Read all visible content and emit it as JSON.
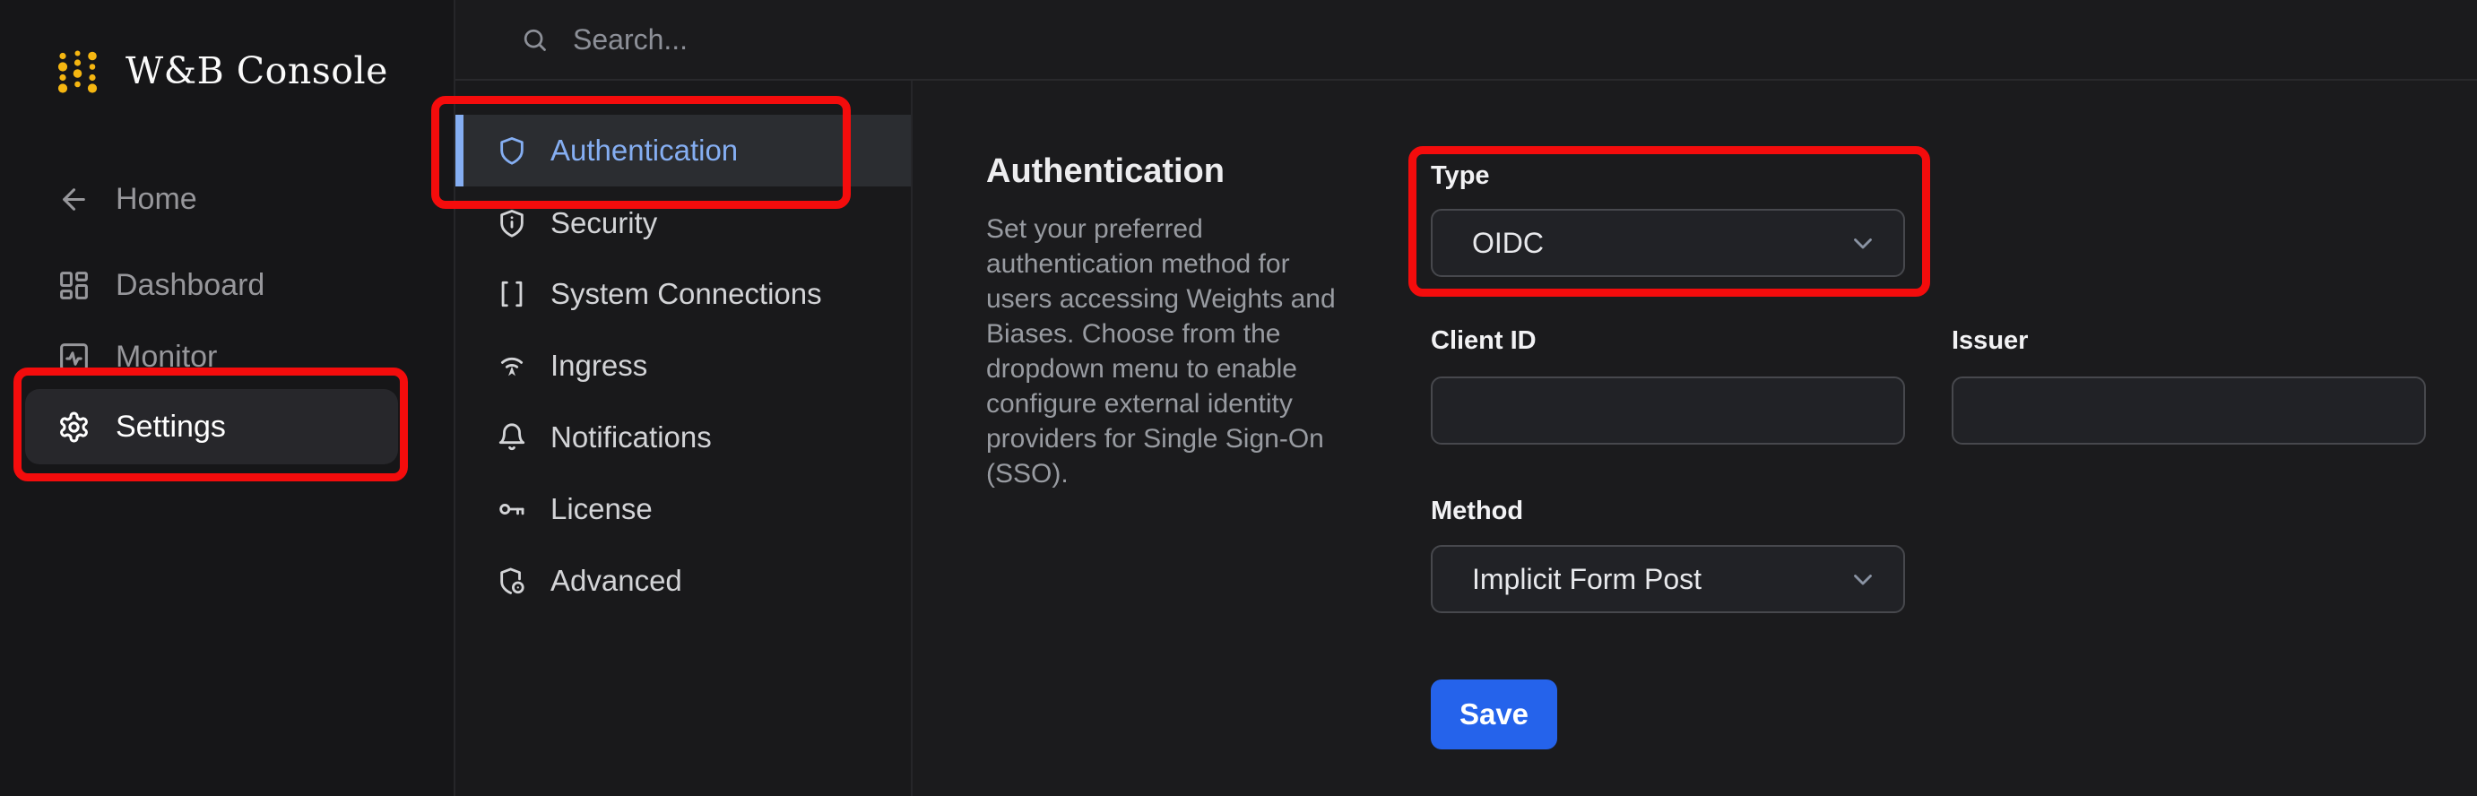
{
  "app": {
    "title": "W&B Console",
    "logo_icon": "wandb-dots-icon"
  },
  "topbar": {
    "search_placeholder": "Search...",
    "search_icon": "magnifier-icon"
  },
  "sidebar": {
    "items": [
      {
        "label": "Home",
        "icon": "arrow-left-icon",
        "selected": false
      },
      {
        "label": "Dashboard",
        "icon": "dashboard-icon",
        "selected": false
      },
      {
        "label": "Monitor",
        "icon": "monitor-icon",
        "selected": false
      },
      {
        "label": "Settings",
        "icon": "gear-icon",
        "selected": true
      }
    ]
  },
  "subnav": {
    "items": [
      {
        "label": "Authentication",
        "icon": "shield-icon",
        "selected": true
      },
      {
        "label": "Security",
        "icon": "shield-info-icon",
        "selected": false
      },
      {
        "label": "System Connections",
        "icon": "brackets-icon",
        "selected": false
      },
      {
        "label": "Ingress",
        "icon": "wifi-ingress-icon",
        "selected": false
      },
      {
        "label": "Notifications",
        "icon": "bell-icon",
        "selected": false
      },
      {
        "label": "License",
        "icon": "key-icon",
        "selected": false
      },
      {
        "label": "Advanced",
        "icon": "shield-badge-icon",
        "selected": false
      }
    ]
  },
  "main": {
    "heading": "Authentication",
    "description": "Set your preferred authentication method for users accessing Weights and Biases. Choose from the dropdown menu to enable configure external identity providers for Single Sign-On (SSO).",
    "form": {
      "type": {
        "label": "Type",
        "value": "OIDC"
      },
      "client_id": {
        "label": "Client ID",
        "value": ""
      },
      "issuer": {
        "label": "Issuer",
        "value": ""
      },
      "method": {
        "label": "Method",
        "value": "Implicit Form Post"
      },
      "save_label": "Save"
    }
  },
  "colors": {
    "accent_blue": "#85aef2",
    "save_blue": "#2563eb",
    "annotation_red": "#f40c0c",
    "logo_gold": "#f5b611",
    "background": "#1b1b1d"
  },
  "annotations": [
    {
      "target": "sidebar-item-settings"
    },
    {
      "target": "subnav-item-authentication"
    },
    {
      "target": "type-select"
    }
  ]
}
